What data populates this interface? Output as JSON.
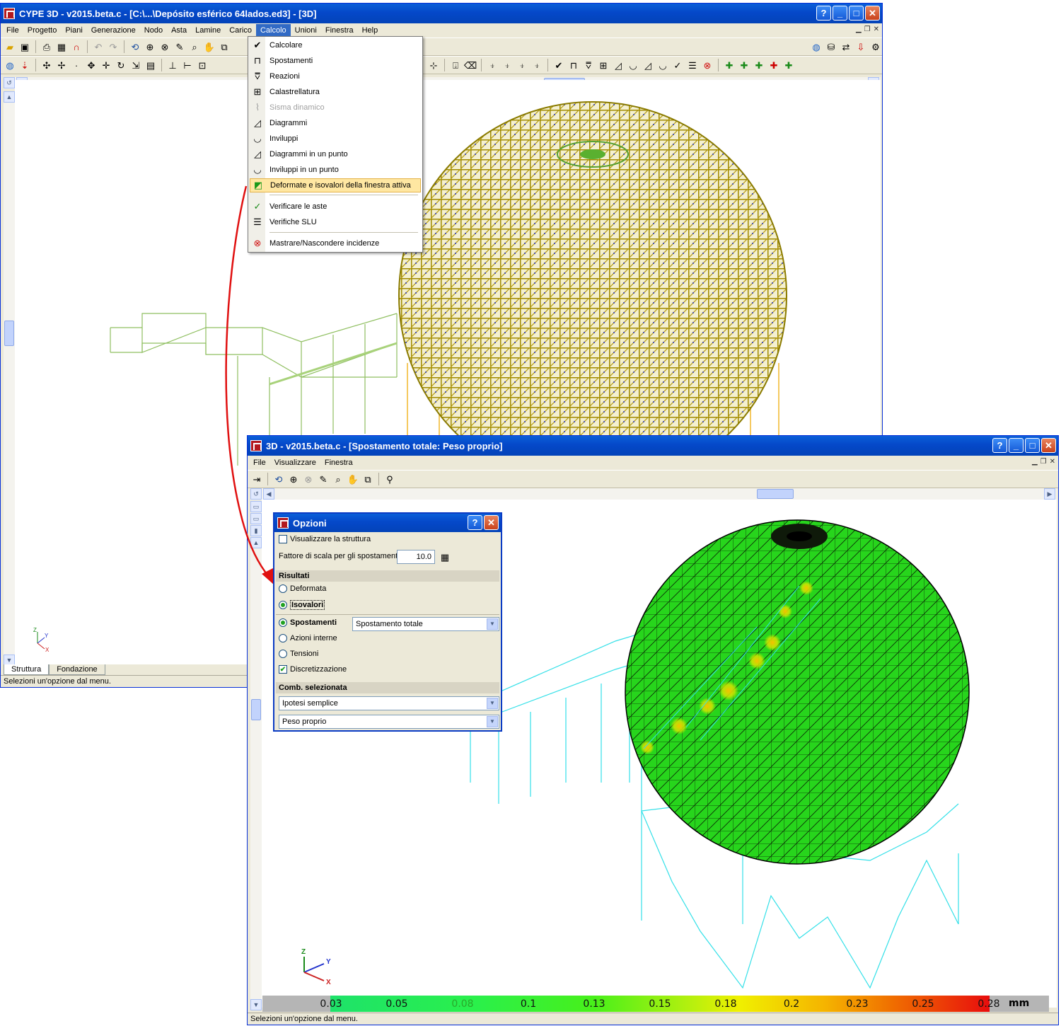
{
  "main_window": {
    "title": "CYPE 3D - v2015.beta.c - [C:\\...\\Depósito esférico 64lados.ed3] - [3D]",
    "menu": [
      "File",
      "Progetto",
      "Piani",
      "Generazione",
      "Nodo",
      "Asta",
      "Lamine",
      "Carico",
      "Calcolo",
      "Unioni",
      "Finestra",
      "Help"
    ],
    "active_menu": "Calcolo",
    "tabs": [
      "Struttura",
      "Fondazione"
    ],
    "status": "Selezioni un'opzione dal menu."
  },
  "calcolo_menu": {
    "items": [
      {
        "label": "Calcolare",
        "icon": "calculate-icon",
        "glyph": "✔"
      },
      {
        "label": "Spostamenti",
        "icon": "displacement-icon",
        "glyph": "⊓"
      },
      {
        "label": "Reazioni",
        "icon": "reactions-icon",
        "glyph": "⩢"
      },
      {
        "label": "Calastrellatura",
        "icon": "lacing-icon",
        "glyph": "⊞"
      },
      {
        "label": "Sisma dinamico",
        "icon": "seismic-icon",
        "glyph": "⌇",
        "disabled": true
      },
      {
        "label": "Diagrammi",
        "icon": "diagrams-icon",
        "glyph": "◿"
      },
      {
        "label": "Inviluppi",
        "icon": "envelopes-icon",
        "glyph": "◡"
      },
      {
        "label": "Diagrammi in un punto",
        "icon": "diagram-point-icon",
        "glyph": "◿"
      },
      {
        "label": "Inviluppi in un punto",
        "icon": "envelope-point-icon",
        "glyph": "◡"
      },
      {
        "label": "Deformate e isovalori della finestra attiva",
        "icon": "isovalues-icon",
        "glyph": "◩",
        "highlight": true
      },
      {
        "label": "Verificare le aste",
        "icon": "check-bars-icon",
        "glyph": "✓"
      },
      {
        "label": "Verifiche SLU",
        "icon": "slu-check-icon",
        "glyph": "☰"
      },
      {
        "label": "Mastrare/Nascondere incidenze",
        "icon": "incidences-icon",
        "glyph": "⊗"
      }
    ]
  },
  "results_window": {
    "title": "3D - v2015.beta.c - [Spostamento totale: Peso proprio]",
    "menu": [
      "File",
      "Visualizzare",
      "Finestra"
    ],
    "status": "Selezioni un'opzione dal menu.",
    "legend": {
      "values": [
        "0.03",
        "0.05",
        "0.08",
        "0.1",
        "0.13",
        "0.15",
        "0.18",
        "0.2",
        "0.23",
        "0.25",
        "0.28"
      ],
      "unit": "mm"
    }
  },
  "options_dialog": {
    "title": "Opzioni",
    "show_structure_label": "Visualizzare la struttura",
    "show_structure_checked": false,
    "scale_label": "Fattore di scala per gli spostamenti",
    "scale_value": "10.0",
    "results_header": "Risultati",
    "radio_deformata": "Deformata",
    "radio_isovalori": "Isovalori",
    "radio_spostamenti": "Spostamenti",
    "spostamenti_select": "Spostamento totale",
    "radio_azioni": "Azioni interne",
    "radio_tensioni": "Tensioni",
    "discretizzazione_label": "Discretizzazione",
    "discretizzazione_checked": true,
    "comb_header": "Comb. selezionata",
    "hypothesis_select": "Ipotesi semplice",
    "load_select": "Peso proprio"
  },
  "axes": {
    "x": "X",
    "y": "Y",
    "z": "Z"
  },
  "colors": {
    "accent": "#316ac5",
    "title_blue": "#0548c9",
    "sphere_main": "#c9a400",
    "mesh_green": "#22d11a",
    "wire_cyan": "#33e0e8",
    "arrow_red": "#e01010"
  }
}
